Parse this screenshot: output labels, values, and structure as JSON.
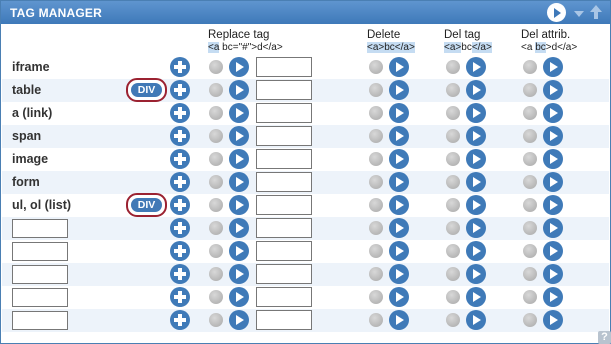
{
  "title": "TAG MANAGER",
  "columns": {
    "replace": {
      "label": "Replace tag",
      "sample": [
        "<a",
        " bc=\"#\">d</a>"
      ]
    },
    "delete": {
      "label": "Delete",
      "sample": [
        "<a>bc</a>"
      ]
    },
    "deltag": {
      "label": "Del tag",
      "sample": [
        "<a>",
        "b",
        "c",
        "</a>"
      ]
    },
    "delattr": {
      "label": "Del attrib.",
      "sample": [
        "<a ",
        "bc",
        ">d</a>"
      ]
    }
  },
  "rows": [
    {
      "name": "iframe",
      "div": ""
    },
    {
      "name": "table",
      "div": "DIV"
    },
    {
      "name": "a (link)",
      "div": ""
    },
    {
      "name": "span",
      "div": ""
    },
    {
      "name": "image",
      "div": ""
    },
    {
      "name": "form",
      "div": ""
    },
    {
      "name": "ul, ol (list)",
      "div": "DIV"
    },
    {
      "name": "",
      "div": ""
    },
    {
      "name": "",
      "div": ""
    },
    {
      "name": "",
      "div": ""
    },
    {
      "name": "",
      "div": ""
    },
    {
      "name": "",
      "div": ""
    }
  ],
  "help_label": "?"
}
